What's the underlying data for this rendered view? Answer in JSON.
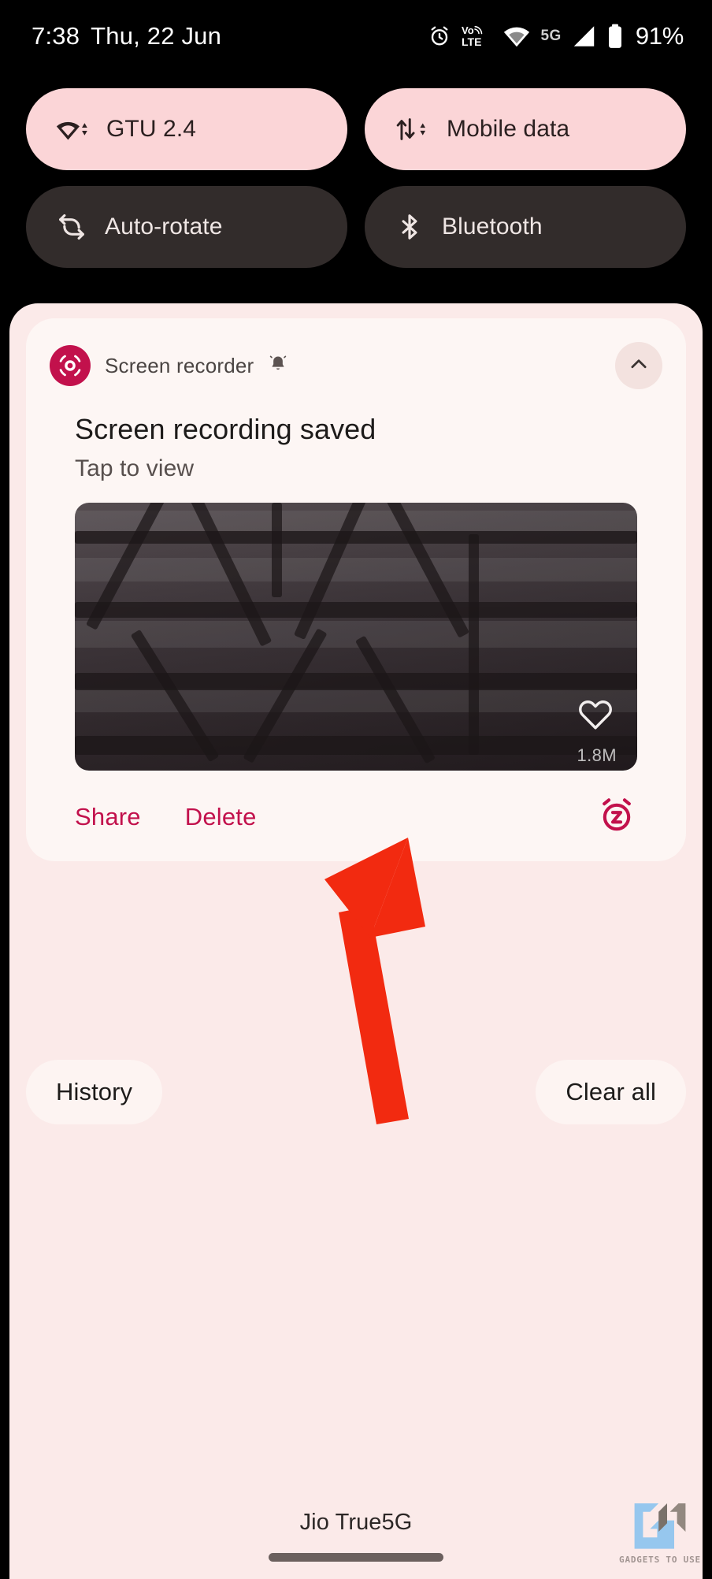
{
  "status_bar": {
    "time": "7:38",
    "date": "Thu, 22 Jun",
    "network_label": "5G",
    "battery_percent": "91%",
    "icons": [
      "alarm-icon",
      "volte-icon",
      "wifi-icon",
      "signal-icon",
      "battery-icon"
    ]
  },
  "quick_settings": {
    "tiles": [
      {
        "label": "GTU 2.4",
        "icon": "wifi-icon",
        "state": "on"
      },
      {
        "label": "Mobile data",
        "icon": "mobile-data-icon",
        "state": "on"
      },
      {
        "label": "Auto-rotate",
        "icon": "auto-rotate-icon",
        "state": "off"
      },
      {
        "label": "Bluetooth",
        "icon": "bluetooth-icon",
        "state": "off"
      }
    ]
  },
  "notification": {
    "app_name": "Screen recorder",
    "app_icon": "screen-recorder-icon",
    "alert_icon": "bell-icon",
    "collapse_icon": "chevron-up-icon",
    "title": "Screen recording saved",
    "subtitle": "Tap to view",
    "thumbnail_size": "1.8M",
    "favorite_icon": "heart-icon",
    "snooze_icon": "snooze-alarm-icon",
    "actions": [
      {
        "label": "Share"
      },
      {
        "label": "Delete"
      }
    ]
  },
  "footer": {
    "history_label": "History",
    "clear_all_label": "Clear all"
  },
  "system": {
    "carrier": "Jio True5G",
    "home_indicator": "home-indicator"
  },
  "watermark": {
    "text": "GADGETS TO USE"
  },
  "colors": {
    "accent": "#c2114c",
    "tile_on_bg": "#fbd5d7",
    "tile_off_bg": "#322c2b",
    "shade_bg": "#fbeae9",
    "notification_bg": "#fdf6f4",
    "arrow": "#f22a10",
    "background": "#000000"
  }
}
